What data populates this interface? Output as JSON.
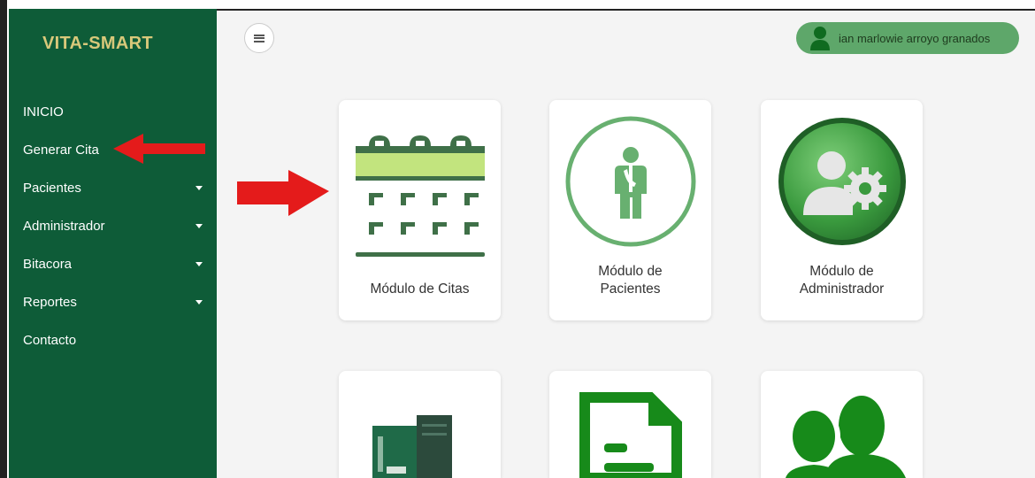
{
  "brand": "VITA-SMART",
  "sidebar": {
    "items": [
      {
        "label": "INICIO",
        "has_caret": false
      },
      {
        "label": "Generar Cita",
        "has_caret": false
      },
      {
        "label": "Pacientes",
        "has_caret": true
      },
      {
        "label": "Administrador",
        "has_caret": true
      },
      {
        "label": "Bitacora",
        "has_caret": true
      },
      {
        "label": "Reportes",
        "has_caret": true
      },
      {
        "label": "Contacto",
        "has_caret": false
      }
    ]
  },
  "header": {
    "menu_icon": "hamburger-icon",
    "user_name": "ian marlowie arroyo granados",
    "user_icon": "user-icon"
  },
  "modules": [
    {
      "label": "Módulo de Citas",
      "icon": "calendar-icon"
    },
    {
      "label": "Módulo de Pacientes",
      "label_lines": [
        "Módulo de",
        "Pacientes"
      ],
      "icon": "doctor-icon"
    },
    {
      "label": "Módulo de Administrador",
      "label_lines": [
        "Módulo de",
        "Administrador"
      ],
      "icon": "admin-gear-icon"
    },
    {
      "icon": "server-icon"
    },
    {
      "icon": "report-document-icon"
    },
    {
      "icon": "users-icon"
    }
  ],
  "colors": {
    "sidebar_bg": "#0e5c38",
    "brand_text": "#d8c87a",
    "accent_green": "#5ea76a",
    "dark_green": "#3f7048",
    "annotation_red": "#e41b1b"
  }
}
